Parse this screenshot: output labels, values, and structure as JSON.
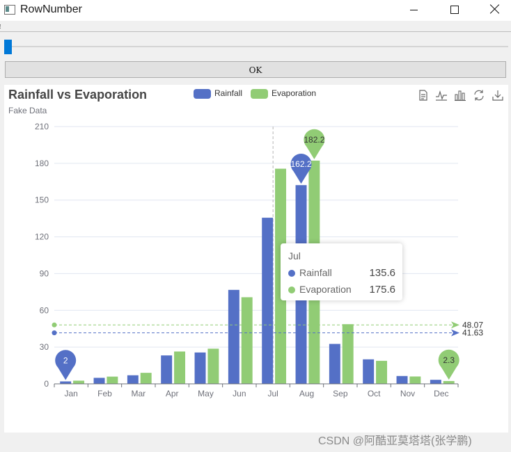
{
  "window": {
    "title": "RowNumber"
  },
  "controls": {
    "ok_label": "OK",
    "slider_value": 0
  },
  "chart_data": {
    "type": "bar",
    "title": "Rainfall vs Evaporation",
    "subtitle": "Fake Data",
    "categories": [
      "Jan",
      "Feb",
      "Mar",
      "Apr",
      "May",
      "Jun",
      "Jul",
      "Aug",
      "Sep",
      "Oct",
      "Nov",
      "Dec"
    ],
    "series": [
      {
        "name": "Rainfall",
        "color": "#5470c6",
        "values": [
          2.0,
          4.9,
          7.0,
          23.2,
          25.6,
          76.7,
          135.6,
          162.2,
          32.6,
          20.0,
          6.4,
          3.3
        ]
      },
      {
        "name": "Evaporation",
        "color": "#91cc75",
        "values": [
          2.6,
          5.9,
          9.0,
          26.4,
          28.7,
          70.7,
          175.6,
          182.2,
          48.7,
          18.8,
          6.0,
          2.3
        ]
      }
    ],
    "ylim": [
      0,
      210
    ],
    "yticks": [
      0,
      30,
      60,
      90,
      120,
      150,
      180,
      210
    ],
    "mark_points": [
      {
        "series": 0,
        "category": "Aug",
        "value": 162.2,
        "label": "162.2"
      },
      {
        "series": 0,
        "category": "Jan",
        "value": 2.0,
        "label": "2"
      },
      {
        "series": 1,
        "category": "Aug",
        "value": 182.2,
        "label": "182.2"
      },
      {
        "series": 1,
        "category": "Dec",
        "value": 2.3,
        "label": "2.3"
      }
    ],
    "mark_lines": [
      {
        "series": 0,
        "value": 41.63,
        "label": "41.63"
      },
      {
        "series": 1,
        "value": 48.07,
        "label": "48.07"
      }
    ],
    "legend_position": "top-center",
    "grid": "horizontal",
    "tooltip": {
      "title": "Jul",
      "rows": [
        {
          "name": "Rainfall",
          "value": "135.6",
          "color": "#5470c6"
        },
        {
          "name": "Evaporation",
          "value": "175.6",
          "color": "#91cc75"
        }
      ]
    },
    "toolbox_icons": [
      "data-view-icon",
      "line-chart-icon",
      "bar-chart-icon",
      "restore-icon",
      "download-icon"
    ]
  },
  "watermark": "CSDN @阿酷亚莫塔塔(张学鹏)"
}
